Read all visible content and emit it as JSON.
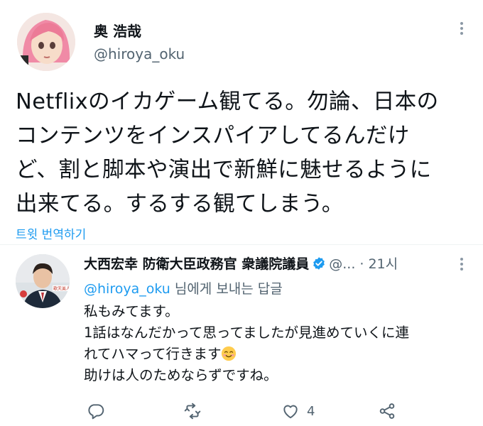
{
  "main_tweet": {
    "author_name": "奥 浩哉",
    "author_handle": "@hiroya_oku",
    "text_lines": [
      "Netflixのイカゲーム観てる。勿論、日本の",
      "コンテンツをインスパイアしてるんだけ",
      "ど、割と脚本や演出で新鮮に魅せるように",
      "出来てる。するする観てしまう。"
    ],
    "translate_label": "트윗 번역하기"
  },
  "reply": {
    "author_name": "大西宏幸 防衛大臣政務官 衆議院議員",
    "author_handle": "@...",
    "separator": "·",
    "time": "21시",
    "replying_to_mention": "@hiroya_oku",
    "replying_to_suffix": " 님에게 보내는 답글",
    "lines": [
      "私もみてます。",
      "1話はなんだかって思ってましたが見進めていくに連",
      "れてハマって行きます",
      "助けは人のためならずですね。"
    ],
    "avatar_badge_text": "歌天美人",
    "like_count": "4"
  },
  "icons": {
    "reply": "reply-icon",
    "retweet": "retweet-icon",
    "like": "heart-icon",
    "share": "share-icon",
    "verified": "verified-badge-icon",
    "more": "more-icon",
    "emoji": "smiling-face-emoji"
  },
  "colors": {
    "accent": "#1d9bf0",
    "secondary_text": "#536471",
    "primary_text": "#0f1419"
  }
}
